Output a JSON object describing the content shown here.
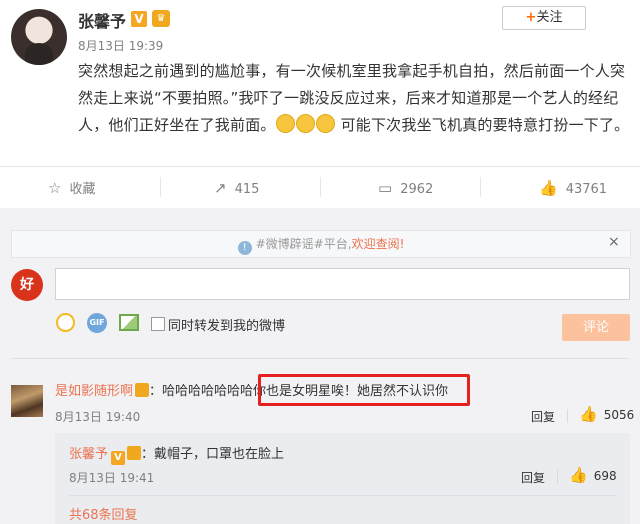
{
  "post": {
    "author": "张馨予",
    "verified_badge": "V",
    "member_badge": "♛",
    "time": "8月13日 19:39",
    "follow_label": "关注",
    "text_part1": "突然想起之前遇到的尴尬事，有一次候机室里我拿起手机自拍，然后前面一个人突然走上来说“不要拍照。”我吓了一跳没反应过来，后来才知道那是一个艺人的经纪人，他们正好坐在了我前面。",
    "text_part2": "可能下次我坐飞机真的要特意打扮一下了。"
  },
  "actions": {
    "favorite_label": "收藏",
    "repost_count": "415",
    "comment_count": "2962",
    "like_count": "43761"
  },
  "rumor_bar": {
    "tag": "#微博辟谣#平台,",
    "link": "欢迎查阅!",
    "close": "×"
  },
  "composer": {
    "avatar_text": "好",
    "repost_checkbox_label": "同时转发到我的微博",
    "submit_label": "评论",
    "gif_label": "GIF"
  },
  "comments": [
    {
      "user": "是如影随形啊",
      "sep": "：",
      "text": "哈哈哈哈哈哈哈你也是女明星唉！她居然不认识你",
      "time": "8月13日 19:40",
      "reply_label": "回复",
      "likes": "5056"
    }
  ],
  "nested_reply": {
    "user": "张馨予",
    "verified_badge": "V",
    "sep": "：",
    "text": "戴帽子，口罩也在脸上",
    "time": "8月13日 19:41",
    "reply_label": "回复",
    "likes": "698",
    "more_label": "共68条回复"
  },
  "colors": {
    "link": "#eb7350",
    "highlight_box": "#e61f1f",
    "submit_disabled": "#fcc29e"
  },
  "icons": [
    "star-icon",
    "repost-icon",
    "comment-icon",
    "thumbs-up-icon",
    "info-icon",
    "smile-icon",
    "gif-icon",
    "image-icon"
  ]
}
